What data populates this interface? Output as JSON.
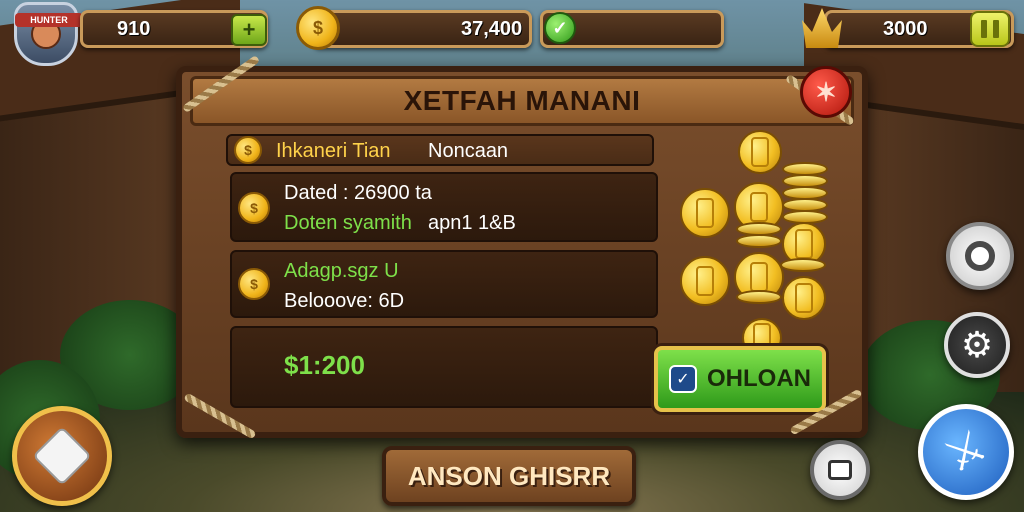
{
  "hud": {
    "player_tag": "HUNTER",
    "level_value": "910",
    "gold_value": "37,400",
    "crown_value": "3000"
  },
  "panel": {
    "title": "XETFAH MANANI",
    "header_row": {
      "label_gold": "Ihkaneri Tian",
      "label_white": "Noncaan"
    },
    "row1": {
      "line1": "Dated : 26900 ta",
      "line2_green": "Doten syamith",
      "line2_white": "apn1 1&B"
    },
    "row2": {
      "line1": "Adagp.sgz U",
      "line2": "Belooove: 6D"
    },
    "row3": {
      "amount": "$1:200"
    },
    "confirm_label": "OHLOAN"
  },
  "bottom_button_label": "ANSON GHISRR",
  "icons": {
    "avatar": "avatar-icon",
    "plus": "plus-icon",
    "coin": "coin-icon",
    "check": "check-icon",
    "crown": "crown-icon",
    "pause": "pause-icon",
    "close": "close-icon",
    "compass": "compass-icon",
    "settings": "gear-icon",
    "map": "map-icon",
    "camera": "camera-icon",
    "attack": "sword-icon"
  },
  "colors": {
    "accent_gold": "#ffd24a",
    "accent_green": "#7ee04a",
    "wood": "#7a4e2c",
    "close_red": "#b0160c"
  }
}
